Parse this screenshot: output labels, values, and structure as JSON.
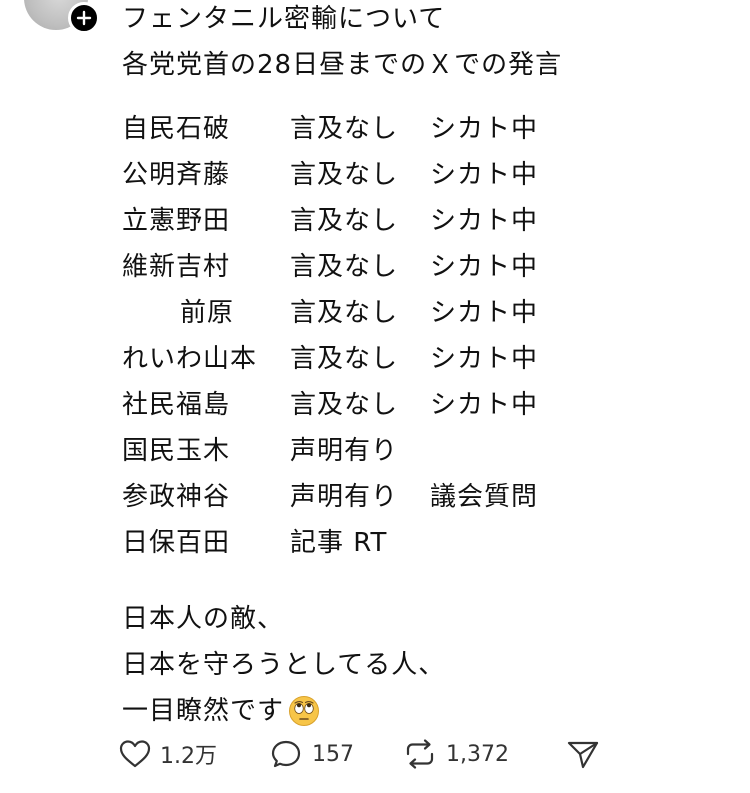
{
  "post": {
    "intro_lines": [
      "フェンタニル密輸について",
      "各党党首の28日昼までのＸでの発言"
    ],
    "rows": [
      {
        "name": "自民石破",
        "x_post": "言及なし",
        "action": "シカト中"
      },
      {
        "name": "公明斉藤",
        "x_post": "言及なし",
        "action": "シカト中"
      },
      {
        "name": "立憲野田",
        "x_post": "言及なし",
        "action": "シカト中"
      },
      {
        "name": "維新吉村",
        "x_post": "言及なし",
        "action": "シカト中"
      },
      {
        "name": "前原",
        "x_post": "言及なし",
        "action": "シカト中"
      },
      {
        "name": "れいわ山本",
        "x_post": "言及なし",
        "action": "シカト中"
      },
      {
        "name": "社民福島",
        "x_post": "言及なし",
        "action": "シカト中"
      },
      {
        "name": "国民玉木",
        "x_post": "声明有り",
        "action": ""
      },
      {
        "name": "参政神谷",
        "x_post": "声明有り",
        "action": "議会質問"
      },
      {
        "name": "日保百田",
        "x_post": "記事 RT",
        "action": ""
      }
    ],
    "closing_lines": [
      "日本人の敵、",
      "日本を守ろうとしてる人、",
      "一目瞭然です"
    ],
    "emoji": "face-with-rolling-eyes"
  },
  "actions": {
    "likes": "1.2万",
    "replies": "157",
    "reposts": "1,372"
  },
  "icons": {
    "like": "heart-icon",
    "reply": "reply-bubble-icon",
    "repost": "repost-arrows-icon",
    "share": "share-send-icon",
    "follow": "plus-icon"
  }
}
